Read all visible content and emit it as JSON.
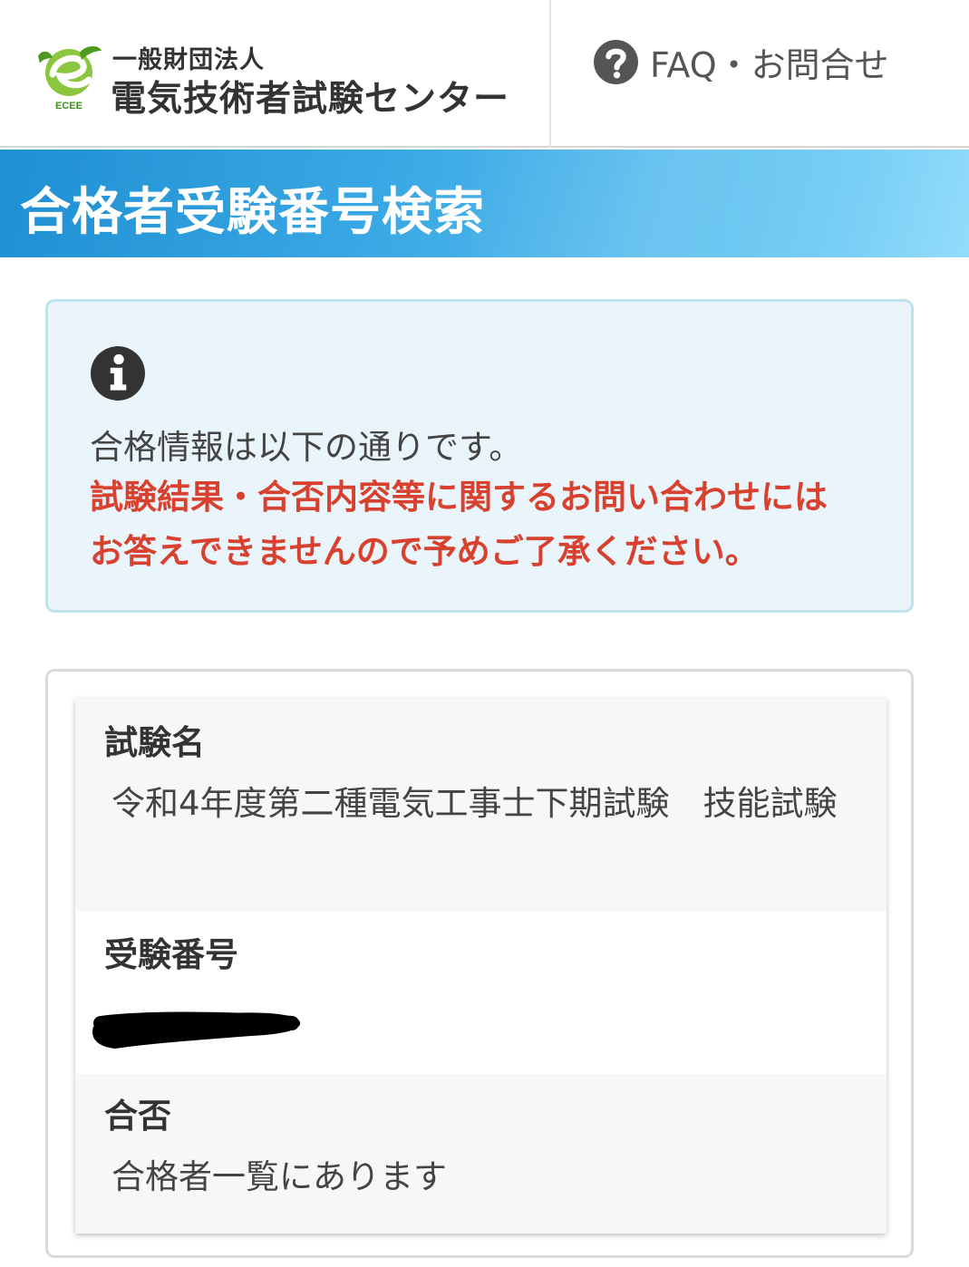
{
  "header": {
    "logo": {
      "mark_text": "ECEE",
      "sub_name": "一般財団法人",
      "name": "電気技術者試験センター"
    },
    "faq": {
      "label": "FAQ・お問合せ",
      "icon": "question-circle-icon"
    }
  },
  "title_bar": {
    "title": "合格者受験番号検索"
  },
  "info": {
    "icon": "info-circle-icon",
    "message": "合格情報は以下の通りです。",
    "warning_line1": "試験結果・合否内容等に関するお問い合わせには",
    "warning_line2": "お答えできませんので予めご了承ください。"
  },
  "result": {
    "fields": [
      {
        "label": "試験名",
        "value": "令和4年度第二種電気工事士下期試験　技能試験"
      },
      {
        "label": "受験番号",
        "value": ""
      },
      {
        "label": "合否",
        "value": "合格者一覧にあります"
      }
    ]
  },
  "colors": {
    "title_gradient_start": "#1e8fd3",
    "title_gradient_end": "#93dcfb",
    "warning": "#d9412f",
    "info_background": "#e9f4fb",
    "info_border": "#bfe3ee",
    "logo_green": "#6bb82e"
  }
}
